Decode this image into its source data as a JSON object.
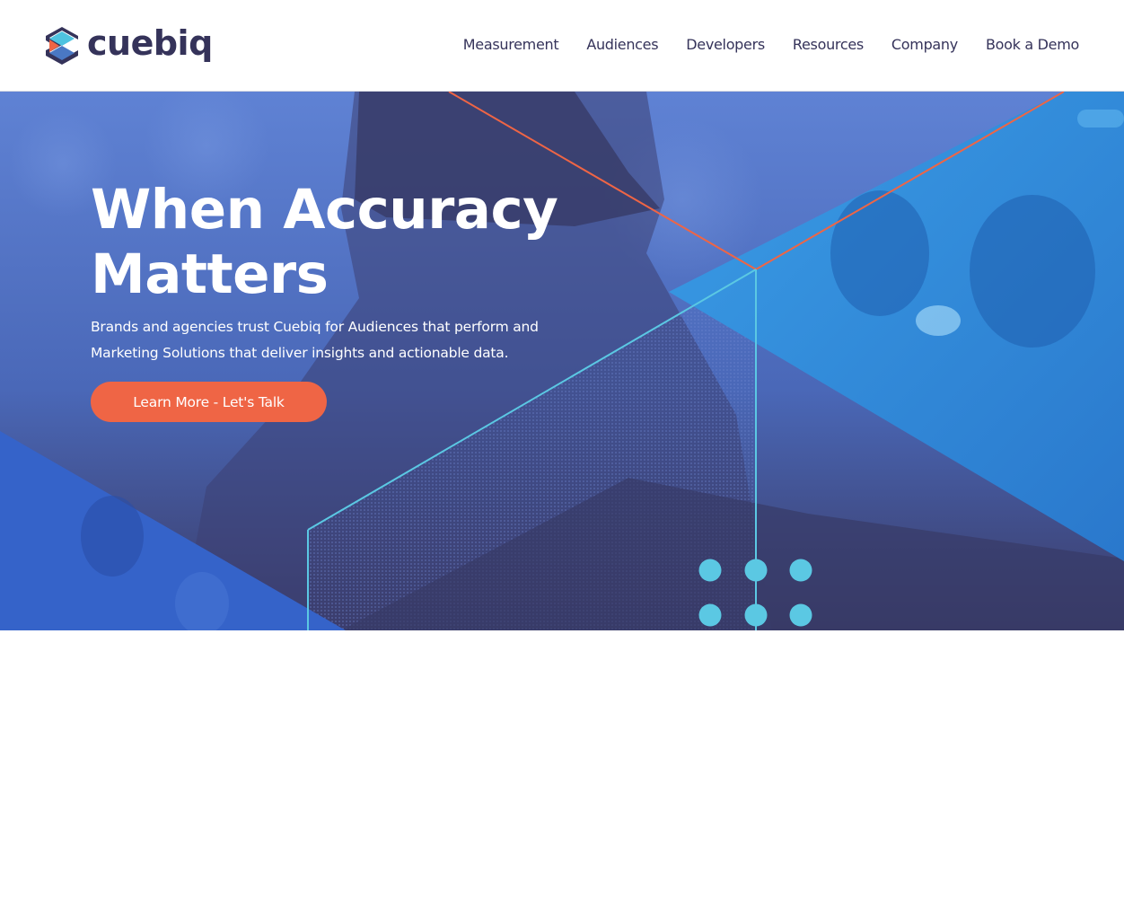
{
  "brand": {
    "name": "cuebiq",
    "logo_icon": "cuebiq-hexagon-logo-icon",
    "colors": {
      "navy": "#35335a",
      "logo_cyan": "#4ec3e0",
      "logo_blue": "#4a78c4",
      "logo_orange": "#ef6545"
    }
  },
  "nav": {
    "items": [
      {
        "label": "Measurement"
      },
      {
        "label": "Audiences"
      },
      {
        "label": "Developers"
      },
      {
        "label": "Resources"
      },
      {
        "label": "Company"
      },
      {
        "label": "Book a Demo"
      }
    ]
  },
  "hero": {
    "title_line1": "When Accuracy",
    "title_line2": "Matters",
    "subtitle_line1": "Brands and agencies trust Cuebiq for Audiences that perform and",
    "subtitle_line2": "Marketing Solutions that deliver insights and actionable data.",
    "cta_label": "Learn More - Let's Talk",
    "colors": {
      "base_navy": "#3a3a66",
      "photo_blue": "#5a7fcf",
      "bright_blue": "#2f8fe0",
      "left_blue": "#3563c9",
      "accent_orange": "#ef6545",
      "accent_cyan": "#5bc8e3"
    },
    "decor": {
      "dots_icon": "dot-grid-icon",
      "dot_count": 6
    }
  }
}
